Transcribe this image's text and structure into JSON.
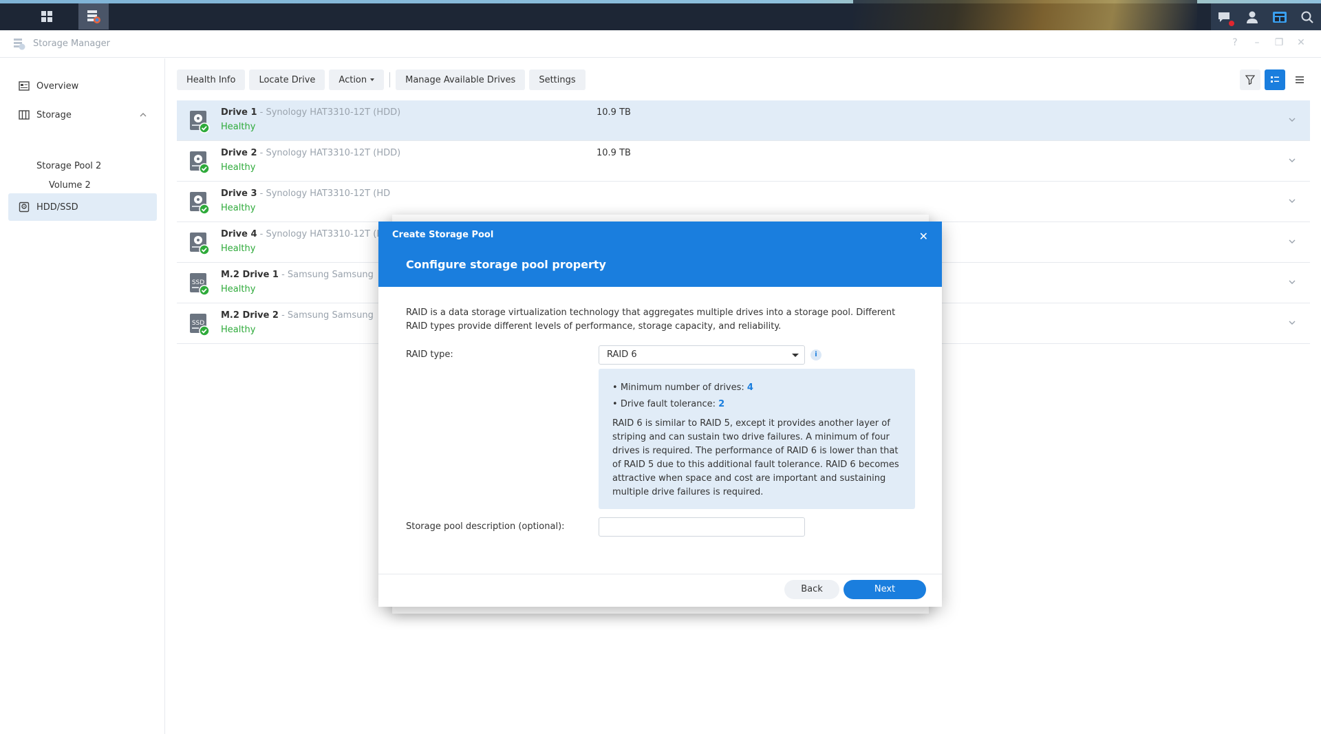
{
  "taskbar": {
    "icons": [
      "apps-grid-icon",
      "storage-manager-app-icon",
      "notifications-icon",
      "user-icon",
      "widgets-icon",
      "search-icon"
    ]
  },
  "window": {
    "title": "Storage Manager"
  },
  "sidebar": {
    "overview": "Overview",
    "storage": "Storage",
    "storage_pool": "Storage Pool 2",
    "volume": "Volume 2",
    "hdd_ssd": "HDD/SSD"
  },
  "toolbar": {
    "health_info": "Health Info",
    "locate_drive": "Locate Drive",
    "action": "Action",
    "manage_drives": "Manage Available Drives",
    "settings": "Settings"
  },
  "drives": [
    {
      "name": "Drive 1",
      "model": " - Synology HAT3310-12T (HDD)",
      "status": "Healthy",
      "size": "10.9 TB",
      "type": "hdd"
    },
    {
      "name": "Drive 2",
      "model": " - Synology HAT3310-12T (HDD)",
      "status": "Healthy",
      "size": "10.9 TB",
      "type": "hdd"
    },
    {
      "name": "Drive 3",
      "model": " - Synology HAT3310-12T (HD",
      "status": "Healthy",
      "size": "",
      "type": "hdd"
    },
    {
      "name": "Drive 4",
      "model": " - Synology HAT3310-12T (H",
      "status": "Healthy",
      "size": "",
      "type": "hdd"
    },
    {
      "name": "M.2 Drive 1",
      "model": " - Samsung Samsung",
      "status": "Healthy",
      "size": "",
      "type": "ssd"
    },
    {
      "name": "M.2 Drive 2",
      "model": " - Samsung Samsung",
      "status": "Healthy",
      "size": "",
      "type": "ssd"
    }
  ],
  "ssd_label": "SSD",
  "modal": {
    "caption": "Create Storage Pool",
    "title": "Configure storage pool property",
    "description": "RAID is a data storage virtualization technology that aggregates multiple drives into a storage pool. Different RAID types provide different levels of performance, storage capacity, and reliability.",
    "raid_label": "RAID type:",
    "raid_value": "RAID 6",
    "info_icon": "i",
    "min_drives_label": "Minimum number of drives: ",
    "min_drives_value": "4",
    "fault_label": "Drive fault tolerance: ",
    "fault_value": "2",
    "raid_description": "RAID 6 is similar to RAID 5, except it provides another layer of striping and can sustain two drive failures. A minimum of four drives is required. The performance of RAID 6 is lower than that of RAID 5 due to this additional fault tolerance. RAID 6 becomes attractive when space and cost are important and sustaining multiple drive failures is required.",
    "pool_desc_label": "Storage pool description (optional):",
    "pool_desc_value": "",
    "back": "Back",
    "next": "Next",
    "close": "✕"
  },
  "colors": {
    "accent": "#1a7ede",
    "healthy": "#2eaa3a",
    "selected_row": "#e1ecf7"
  }
}
